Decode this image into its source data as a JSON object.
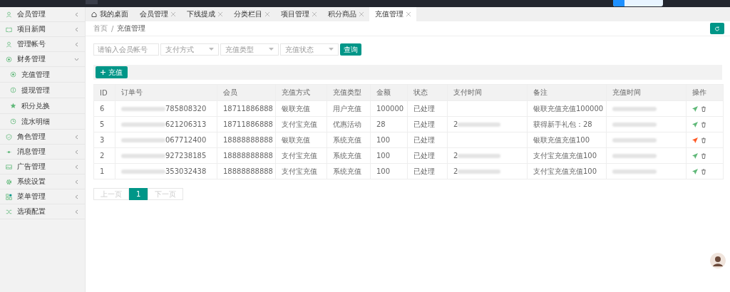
{
  "sidebar": {
    "items": [
      {
        "label": "会员管理",
        "expanded": false
      },
      {
        "label": "项目新闻",
        "expanded": false
      },
      {
        "label": "管理帐号",
        "expanded": false
      },
      {
        "label": "财务管理",
        "expanded": true,
        "children": [
          {
            "label": "充值管理"
          },
          {
            "label": "提现管理"
          },
          {
            "label": "积分兑换"
          },
          {
            "label": "流水明细"
          }
        ]
      },
      {
        "label": "角色管理",
        "expanded": false
      },
      {
        "label": "消息管理",
        "expanded": false
      },
      {
        "label": "广告管理",
        "expanded": false
      },
      {
        "label": "系统设置",
        "expanded": false
      },
      {
        "label": "菜单管理",
        "expanded": false
      },
      {
        "label": "选项配置",
        "expanded": false
      }
    ]
  },
  "tabs": [
    {
      "label": "我的桌面",
      "kind": "home",
      "selected": false
    },
    {
      "label": "会员管理",
      "kind": "closable",
      "selected": false
    },
    {
      "label": "下线提成",
      "kind": "closable",
      "selected": false
    },
    {
      "label": "分类栏目",
      "kind": "closable",
      "selected": false
    },
    {
      "label": "项目管理",
      "kind": "closable",
      "selected": false
    },
    {
      "label": "积分商品",
      "kind": "closable",
      "selected": false
    },
    {
      "label": "充值管理",
      "kind": "closable",
      "selected": true
    }
  ],
  "breadcrumb": [
    "首页",
    "/",
    "充值管理"
  ],
  "filters": {
    "search": {
      "placeholder": "请输入会员帐号"
    },
    "selects": [
      {
        "placeholder": "支付方式"
      },
      {
        "placeholder": "充值类型"
      },
      {
        "placeholder": "充值状态"
      }
    ],
    "query_button": "查询"
  },
  "add_button": "充值",
  "table": {
    "columns": [
      "ID",
      "订单号",
      "会员",
      "充值方式",
      "充值类型",
      "金额",
      "状态",
      "支付时间",
      "备注",
      "充值时间",
      "操作"
    ],
    "rows": [
      {
        "id": "6",
        "order": "785808320",
        "member": "18711886888",
        "method": "银联充值",
        "type": "用户充值",
        "amount": "100000",
        "status": "已处理",
        "remark": "银联充值充值100000",
        "color": "#5fb878"
      },
      {
        "id": "5",
        "order": "621206313",
        "member": "18711886888",
        "method": "支付宝充值",
        "type": "优惠活动",
        "amount": "28",
        "status": "已处理",
        "pay_time": "2",
        "remark": "获得新手礼包：28",
        "color": "#5fb878"
      },
      {
        "id": "3",
        "order": "067712400",
        "member": "18888888888",
        "method": "银联充值",
        "type": "系统充值",
        "amount": "100",
        "status": "已处理",
        "remark": "银联充值充值100",
        "color": "#ff5722"
      },
      {
        "id": "2",
        "order": "927238185",
        "member": "18888888888",
        "method": "支付宝充值",
        "type": "系统充值",
        "amount": "100",
        "status": "已处理",
        "pay_time": "2",
        "remark": "支付宝充值充值100",
        "color": "#5fb878"
      },
      {
        "id": "1",
        "order": "353032438",
        "member": "18888888888",
        "method": "支付宝充值",
        "type": "系统充值",
        "amount": "100",
        "status": "已处理",
        "pay_time": "2",
        "remark": "支付宝充值充值100",
        "color": "#5fb878"
      }
    ]
  },
  "pagination": [
    {
      "label": "上一页",
      "disabled": true,
      "selected": false
    },
    {
      "label": "1",
      "disabled": false,
      "selected": true
    },
    {
      "label": "下一页",
      "disabled": true,
      "selected": false
    }
  ]
}
